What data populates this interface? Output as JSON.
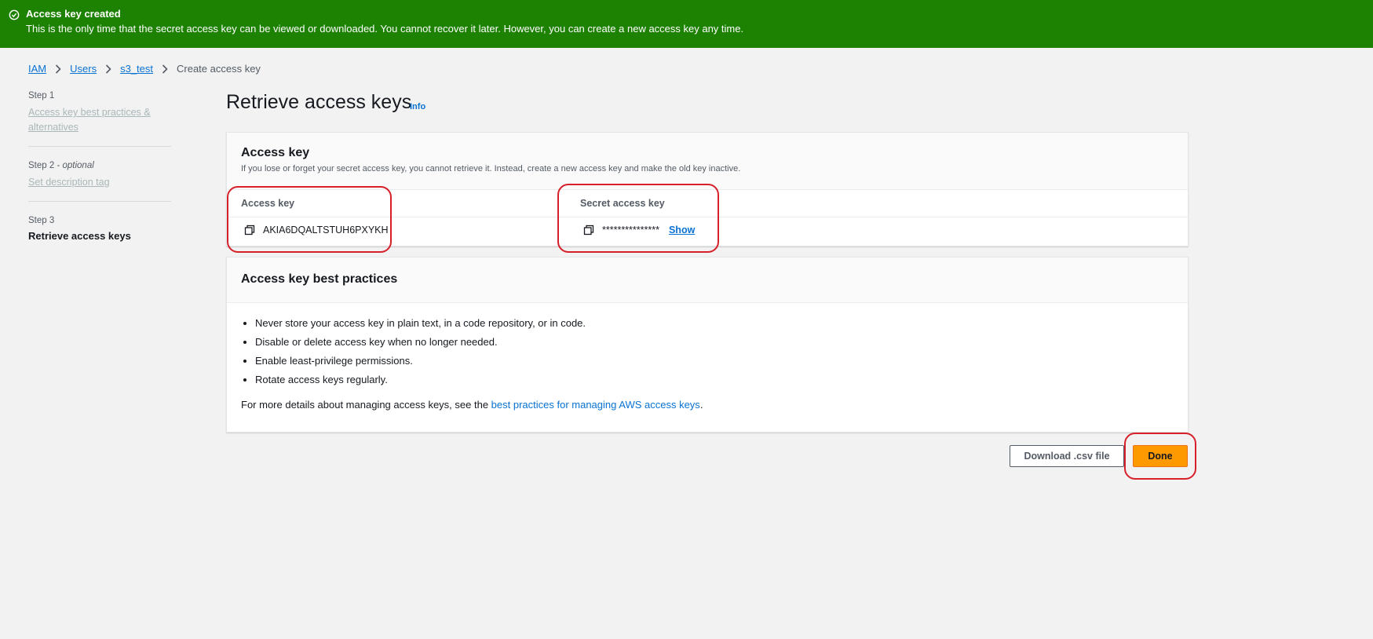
{
  "banner": {
    "title": "Access key created",
    "text": "This is the only time that the secret access key can be viewed or downloaded. You cannot recover it later. However, you can create a new access key any time.",
    "icon": "check-circle-icon",
    "color": "#1d8102"
  },
  "breadcrumb": {
    "items": [
      "IAM",
      "Users",
      "s3_test"
    ],
    "current": "Create access key"
  },
  "steps": [
    {
      "label": "Step 1",
      "label_suffix": "",
      "name": "Access key best practices & alternatives"
    },
    {
      "label": "Step 2",
      "label_suffix": "optional",
      "name": "Set description tag"
    },
    {
      "label": "Step 3",
      "label_suffix": "",
      "name": "Retrieve access keys"
    }
  ],
  "page": {
    "title": "Retrieve access keys",
    "info_label": "Info"
  },
  "access_key_card": {
    "title": "Access key",
    "description": "If you lose or forget your secret access key, you cannot retrieve it. Instead, create a new access key and make the old key inactive.",
    "columns": [
      "Access key",
      "Secret access key"
    ],
    "access_key_value": "AKIA6DQALTSTUH6PXYKH",
    "secret_masked": "***************",
    "show_label": "Show"
  },
  "best_practices_card": {
    "title": "Access key best practices",
    "items": [
      "Never store your access key in plain text, in a code repository, or in code.",
      "Disable or delete access key when no longer needed.",
      "Enable least-privilege permissions.",
      "Rotate access keys regularly."
    ],
    "more_prefix": "For more details about managing access keys, see the ",
    "more_link": "best practices for managing AWS access keys",
    "more_suffix": "."
  },
  "actions": {
    "download_label": "Download .csv file",
    "done_label": "Done",
    "done_color": "#ff9900"
  },
  "annotation_color": "#d6202a"
}
